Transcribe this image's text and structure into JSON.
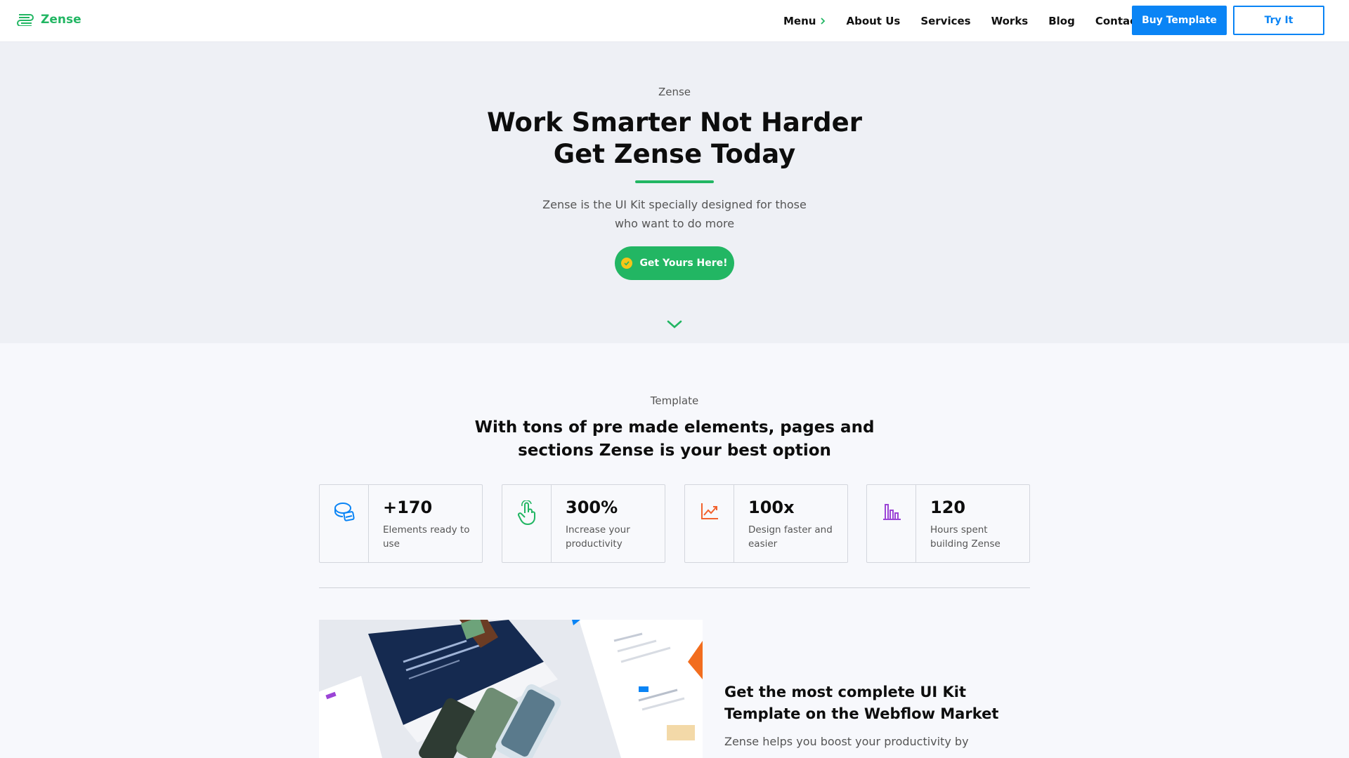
{
  "nav": {
    "brand": "Zense",
    "links": [
      "Menu",
      "About Us",
      "Services",
      "Works",
      "Blog",
      "Contact Us"
    ],
    "buy_label": "Buy Template",
    "try_label": "Try It"
  },
  "hero": {
    "eyebrow": "Zense",
    "title_line1": "Work Smarter Not Harder",
    "title_line2": "Get Zense Today",
    "subtitle_line1": "Zense is the UI Kit specially designed for those",
    "subtitle_line2": "who want to do more",
    "cta_label": "Get Yours Here!"
  },
  "template_section": {
    "eyebrow": "Template",
    "title_line1": "With tons of pre made elements, pages and",
    "title_line2": "sections Zense is your best option",
    "stats": [
      {
        "value": "+170",
        "label": "Elements ready to use",
        "icon": "layers-icon",
        "color": "#0a84f5"
      },
      {
        "value": "300%",
        "label": "Increase your productivity",
        "icon": "hand-pointer-icon",
        "color": "#22b663"
      },
      {
        "value": "100x",
        "label": "Design faster and easier",
        "icon": "trending-chart-icon",
        "color": "#f2622e"
      },
      {
        "value": "120",
        "label": "Hours spent building Zense",
        "icon": "bar-chart-icon",
        "color": "#9b44d6"
      }
    ]
  },
  "feature": {
    "title_line1": "Get the most complete UI Kit",
    "title_line2": "Template on the Webflow Market",
    "text": "Zense helps you boost your productivity by"
  },
  "colors": {
    "accent_green": "#22b663",
    "accent_blue": "#0a84f5",
    "hero_bg": "#eef0f5"
  }
}
